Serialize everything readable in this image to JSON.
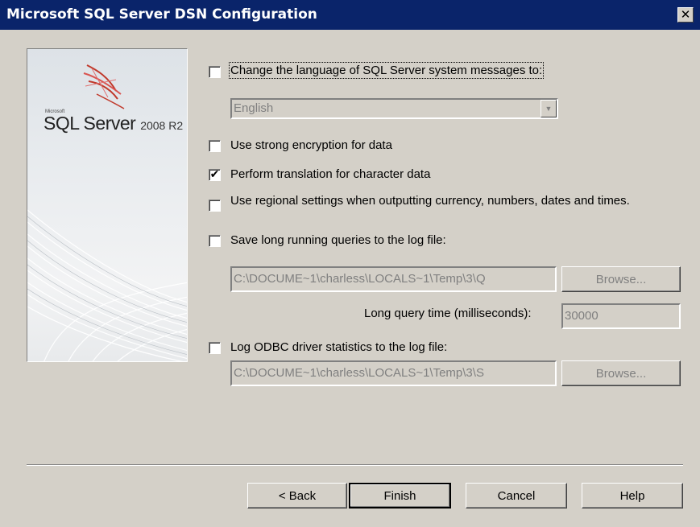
{
  "window": {
    "title": "Microsoft SQL Server DSN Configuration"
  },
  "banner": {
    "company": "Microsoft",
    "product": "SQL Server",
    "version": "2008 R2"
  },
  "options": {
    "change_language": {
      "label": "Change the language of SQL Server system messages to:",
      "checked": false
    },
    "language_select": {
      "value": "English"
    },
    "strong_encryption": {
      "label": "Use strong encryption for data",
      "checked": false
    },
    "translation": {
      "label": "Perform translation for character data",
      "checked": true
    },
    "regional": {
      "label": "Use regional settings when outputting currency, numbers, dates and times.",
      "checked": false
    },
    "long_queries": {
      "label": "Save long running queries to the log file:",
      "checked": false
    },
    "long_query_file": "C:\\DOCUME~1\\charless\\LOCALS~1\\Temp\\3\\Q",
    "long_query_browse": "Browse...",
    "long_query_time_label": "Long query time (milliseconds):",
    "long_query_time_value": "30000",
    "odbc_stats": {
      "label": "Log ODBC driver statistics to the log file:",
      "checked": false
    },
    "odbc_stats_file": "C:\\DOCUME~1\\charless\\LOCALS~1\\Temp\\3\\S",
    "odbc_stats_browse": "Browse..."
  },
  "buttons": {
    "back": "< Back",
    "finish": "Finish",
    "cancel": "Cancel",
    "help": "Help"
  },
  "checkmark_glyph": "✔"
}
